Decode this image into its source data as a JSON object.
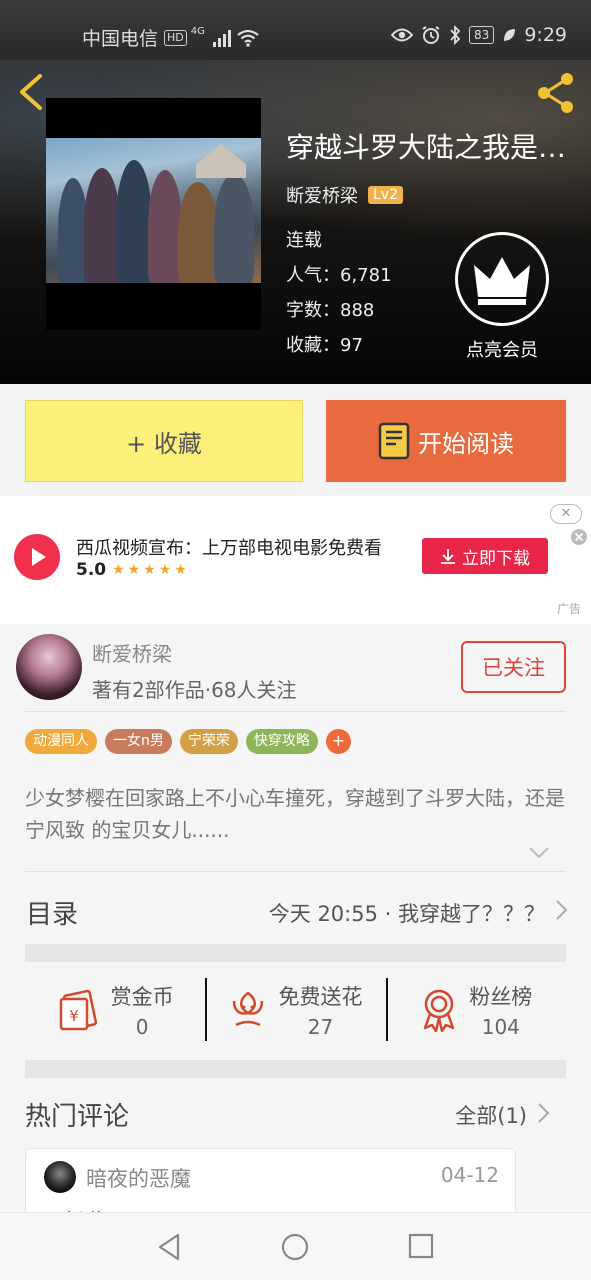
{
  "status_bar": {
    "carrier": "中国电信",
    "hd": "HD",
    "network": "4G",
    "battery": "83",
    "time": "9:29"
  },
  "book": {
    "title": "穿越斗罗大陆之我是宁风致的宝贝女儿",
    "author": "断爱桥梁",
    "level": "Lv2",
    "status": "连载",
    "popularity_label": "人气：",
    "popularity": "6,781",
    "words_label": "字数：",
    "words": "888",
    "favorites_label": "收藏：",
    "favorites": "97"
  },
  "vip": {
    "label": "点亮会员"
  },
  "actions": {
    "favorite_label": "+ 收藏",
    "read_label": "开始阅读"
  },
  "ad": {
    "title": "西瓜视频宣布：上万部电视电影免费看",
    "rating": "5.0",
    "stars": "★★★★★",
    "download_label": "立即下载",
    "close": "✕",
    "tag": "广告"
  },
  "author": {
    "name": "断爱桥梁",
    "stats": "著有2部作品·68人关注",
    "follow_label": "已关注"
  },
  "tags": [
    {
      "label": "动漫同人",
      "color": "#f2a93b"
    },
    {
      "label": "一女n男",
      "color": "#c97c5d"
    },
    {
      "label": "宁荣荣",
      "color": "#d4a046"
    },
    {
      "label": "快穿攻略",
      "color": "#8fb55a"
    }
  ],
  "tag_add": "+",
  "description": "少女梦樱在回家路上不小心车撞死，穿越到了斗罗大陆，还是宁风致 的宝贝女儿......",
  "toc": {
    "title": "目录",
    "latest": "今天 20:55 · 我穿越了？？？"
  },
  "stats": [
    {
      "label": "赏金币",
      "value": "0",
      "icon": "coin-envelope-icon"
    },
    {
      "label": "免费送花",
      "value": "27",
      "icon": "flower-icon"
    },
    {
      "label": "粉丝榜",
      "value": "104",
      "icon": "medal-icon"
    }
  ],
  "comments": {
    "title": "热门评论",
    "all_label": "全部(1)",
    "items": [
      {
        "user": "暗夜的恶魔",
        "date": "04-12",
        "text": "更新啦！"
      }
    ]
  },
  "colors": {
    "accent": "#e96a3e",
    "favorite_bg": "#fbf07a",
    "follow": "#e0453a",
    "ad_download": "#e8264a",
    "level_badge": "#f0b24a"
  }
}
